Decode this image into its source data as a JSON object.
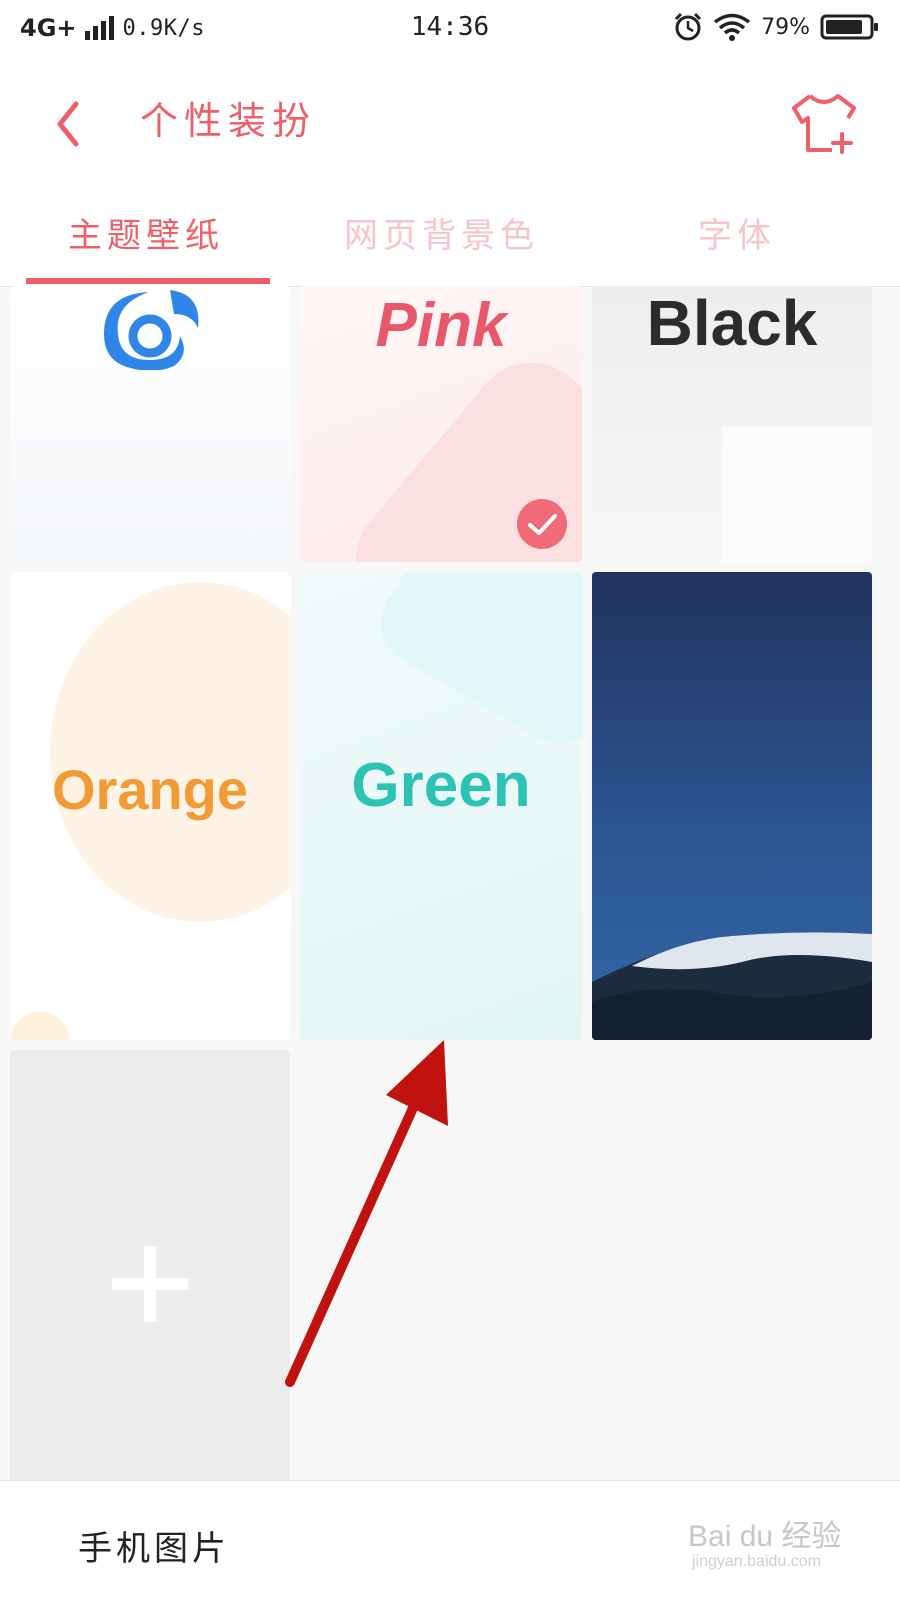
{
  "status_bar": {
    "network": "4G+",
    "speed": "0.9K/s",
    "time": "14:36",
    "battery": "79%",
    "icons": [
      "signal-icon",
      "alarm-icon",
      "wifi-icon",
      "battery-icon"
    ]
  },
  "header": {
    "title": "个性装扮",
    "back_icon": "chevron-left-icon",
    "action_icon": "tshirt-add-icon",
    "accent_color": "#ee5f6a"
  },
  "tabs": [
    {
      "label": "主题壁纸",
      "active": true
    },
    {
      "label": "网页背景色",
      "active": false
    },
    {
      "label": "字体",
      "active": false
    }
  ],
  "themes": [
    {
      "name": "",
      "logo_icon": "uc-squirrel-icon",
      "selected": false
    },
    {
      "name": "Pink",
      "selected": true,
      "check_icon": "check-circle-icon"
    },
    {
      "name": "Black",
      "selected": false
    },
    {
      "name": "Orange",
      "selected": false
    },
    {
      "name": "Green",
      "selected": false
    },
    {
      "name": "",
      "wallpaper": "mountain-photo",
      "selected": false
    }
  ],
  "add_tile": {
    "icon": "plus-icon"
  },
  "bottom_bar": {
    "label": "手机图片",
    "watermark_brand": "Bai du 经验",
    "watermark_url": "jingyan.baidu.com"
  },
  "annotation": {
    "arrow_color": "#c0120e"
  }
}
